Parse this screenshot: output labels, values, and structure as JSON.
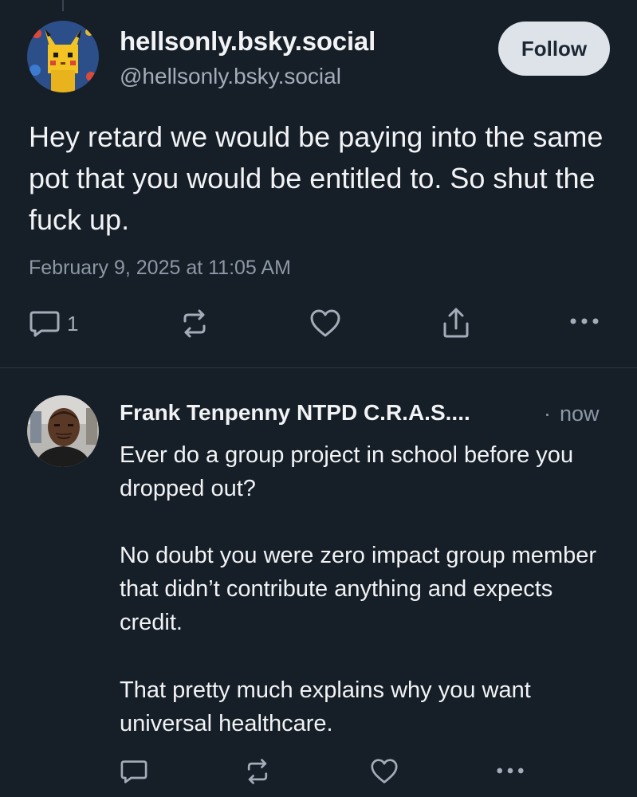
{
  "post": {
    "display_name": "hellsonly.bsky.social",
    "handle": "@hellsonly.bsky.social",
    "follow_label": "Follow",
    "avatar_icon": "pikachu-avatar",
    "text": "Hey retard we would be paying into the same pot that you would be entitled to. So shut the fuck up.",
    "timestamp": "February 9, 2025 at 11:05 AM",
    "actions": {
      "reply_icon": "reply-icon",
      "reply_count": "1",
      "repost_icon": "repost-icon",
      "like_icon": "heart-icon",
      "share_icon": "share-icon",
      "more_icon": "more-icon"
    }
  },
  "reply": {
    "display_name": "Frank Tenpenny NTPD C.R.A.S....",
    "separator": "·",
    "time": "now",
    "avatar_icon": "person-avatar",
    "paragraphs": [
      "Ever do a group project in school before you dropped out?",
      "No doubt you were zero impact group member that didn’t contribute anything and expects credit.",
      "That pretty much explains why you want universal healthcare."
    ],
    "actions": {
      "reply_icon": "reply-icon",
      "repost_icon": "repost-icon",
      "like_icon": "heart-icon",
      "more_icon": "more-icon"
    }
  },
  "colors": {
    "background": "#161e27",
    "text_primary": "#f1f3f5",
    "text_secondary": "#8d98a6",
    "follow_button_bg": "#dde3e9",
    "icon": "#a3adb9"
  }
}
